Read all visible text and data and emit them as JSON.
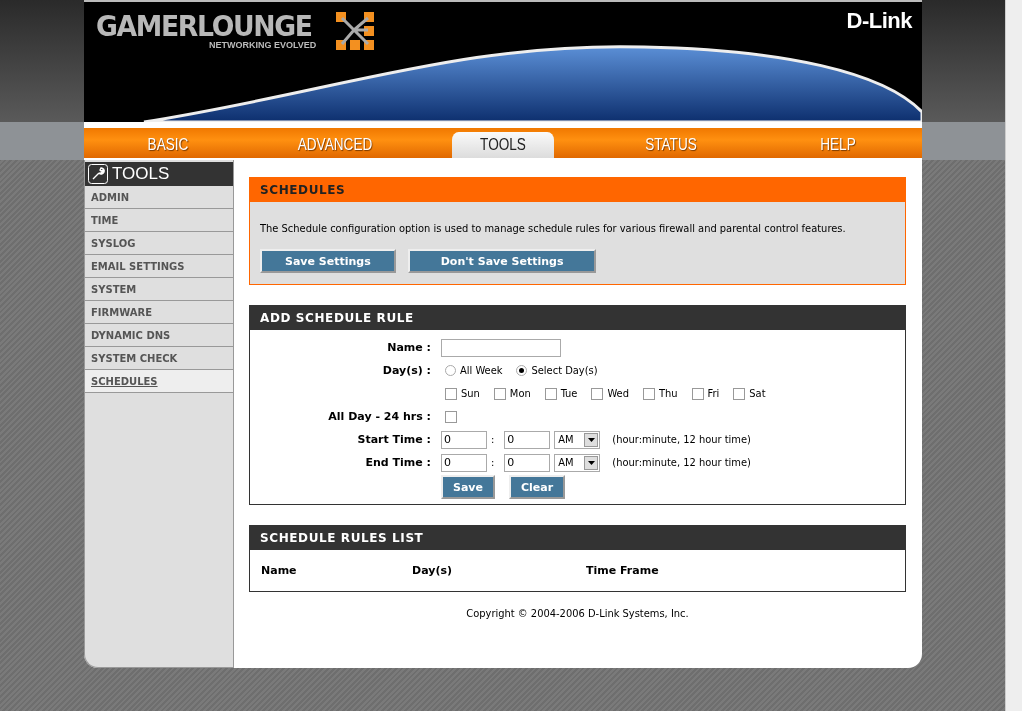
{
  "header": {
    "brand": "GAMERLOUNGE",
    "tagline": "NETWORKING EVOLVED",
    "vendor": "D-Link"
  },
  "nav": [
    {
      "label": "BASIC",
      "selected": false
    },
    {
      "label": "ADVANCED",
      "selected": false
    },
    {
      "label": "TOOLS",
      "selected": true
    },
    {
      "label": "STATUS",
      "selected": false
    },
    {
      "label": "HELP",
      "selected": false
    }
  ],
  "sidebar": {
    "title": "TOOLS",
    "items": [
      {
        "label": "ADMIN",
        "selected": false
      },
      {
        "label": "TIME",
        "selected": false
      },
      {
        "label": "SYSLOG",
        "selected": false
      },
      {
        "label": "EMAIL SETTINGS",
        "selected": false
      },
      {
        "label": "SYSTEM",
        "selected": false
      },
      {
        "label": "FIRMWARE",
        "selected": false
      },
      {
        "label": "DYNAMIC DNS",
        "selected": false
      },
      {
        "label": "SYSTEM CHECK",
        "selected": false
      },
      {
        "label": "SCHEDULES",
        "selected": true
      }
    ]
  },
  "schedules": {
    "title": "SCHEDULES",
    "description": "The Schedule configuration option is used to manage schedule rules for various firewall and parental control features.",
    "buttons": [
      "Save Settings",
      "Don't Save Settings"
    ]
  },
  "add_rule": {
    "title": "ADD SCHEDULE RULE",
    "name": {
      "label": "Name :"
    },
    "days": {
      "label": "Day(s) :",
      "options": [
        {
          "label": "All Week",
          "selected": false
        },
        {
          "label": "Select Day(s)",
          "selected": true
        }
      ],
      "weekdays": [
        {
          "label": "Sun",
          "checked": false
        },
        {
          "label": "Mon",
          "checked": false
        },
        {
          "label": "Tue",
          "checked": false
        },
        {
          "label": "Wed",
          "checked": false
        },
        {
          "label": "Thu",
          "checked": false
        },
        {
          "label": "Fri",
          "checked": false
        },
        {
          "label": "Sat",
          "checked": false
        }
      ]
    },
    "all_day": {
      "label": "All Day - 24 hrs :",
      "checked": false
    },
    "times": [
      {
        "label": "Start Time :",
        "hour": "0",
        "separator": ":",
        "minute": "0",
        "period": "AM",
        "hint": "(hour:minute, 12 hour time)"
      },
      {
        "label": "End Time :",
        "hour": "0",
        "separator": ":",
        "minute": "0",
        "period": "AM",
        "hint": "(hour:minute, 12 hour time)"
      }
    ],
    "buttons": [
      "Save",
      "Clear"
    ]
  },
  "rules_list": {
    "title": "SCHEDULE RULES LIST",
    "columns": [
      "Name",
      "Day(s)",
      "Time Frame"
    ]
  },
  "copyright": "Copyright © 2004-2006 D-Link Systems, Inc."
}
